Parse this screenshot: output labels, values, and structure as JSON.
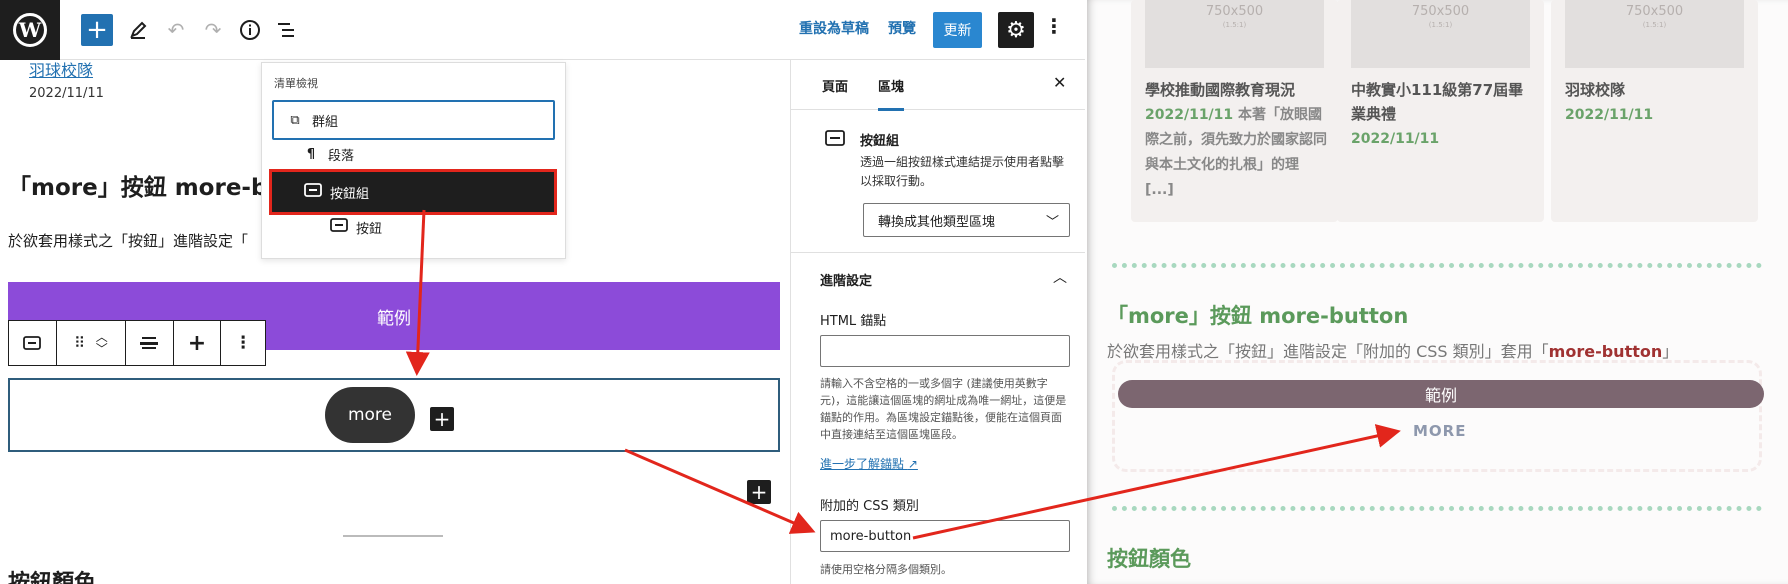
{
  "toolbar": {
    "logo_letter": "W",
    "save_draft": "重設為草稿",
    "preview": "預覽",
    "update": "更新"
  },
  "canvas": {
    "post_link": "羽球校隊",
    "post_date": "2022/11/11",
    "heading": "「more」按鈕 more-butto",
    "paragraph": "於欲套用樣式之「按鈕」進階設定「",
    "example_button": "範例",
    "more_button": "more",
    "heading2": "按鈕顏色"
  },
  "list_view": {
    "title": "清單檢視",
    "items": [
      {
        "label": "群組",
        "icon": "group-icon"
      },
      {
        "label": "段落",
        "icon": "paragraph-icon"
      },
      {
        "label": "按鈕組",
        "icon": "buttons-icon"
      },
      {
        "label": "按鈕",
        "icon": "button-icon"
      }
    ]
  },
  "sidebar": {
    "tab_page": "頁面",
    "tab_block": "區塊",
    "block_title": "按鈕組",
    "block_desc": "透過一組按鈕樣式連結提示使用者點擊以採取行動。",
    "transform": "轉換成其他類型區塊",
    "advanced": "進階設定",
    "anchor_label": "HTML 錨點",
    "anchor_help": "請輸入不含空格的一或多個字 (建議使用英數字元)，這能讓這個區塊的網址成為唯一網址，這便是錨點的作用。為區塊設定錨點後，便能在這個頁面中直接連結至這個區塊區段。",
    "anchor_link": "進一步了解錨點",
    "css_label": "附加的 CSS 類別",
    "css_value": "more-button",
    "css_help": "請使用空格分隔多個類別。"
  },
  "preview": {
    "placeholder": "750x500",
    "placeholder_ratio": "(1.5:1)",
    "cards": [
      {
        "title": "學校推動國際教育現況",
        "date": "2022/11/11",
        "excerpt": "本著「放眼國際之前，須先致力於國家認同與本土文化的扎根」的理 [...]"
      },
      {
        "title": "中教實小111級第77屆畢業典禮",
        "date": "2022/11/11",
        "excerpt": ""
      },
      {
        "title": "羽球校隊",
        "date": "2022/11/11",
        "excerpt": ""
      }
    ],
    "heading": "「more」按鈕 more-button",
    "para_before": "於欲套用樣式之「按鈕」進階設定「附加的 CSS 類別」套用「",
    "para_highlight": "more-button",
    "para_after": "」",
    "example_button": "範例",
    "more_link": "MORE",
    "heading2": "按鈕顏色"
  },
  "colors": {
    "wp_blue": "#2271b1",
    "purple": "#8c4bd9",
    "annotation_red": "#e2261c",
    "preview_green": "#5b9a5b"
  }
}
